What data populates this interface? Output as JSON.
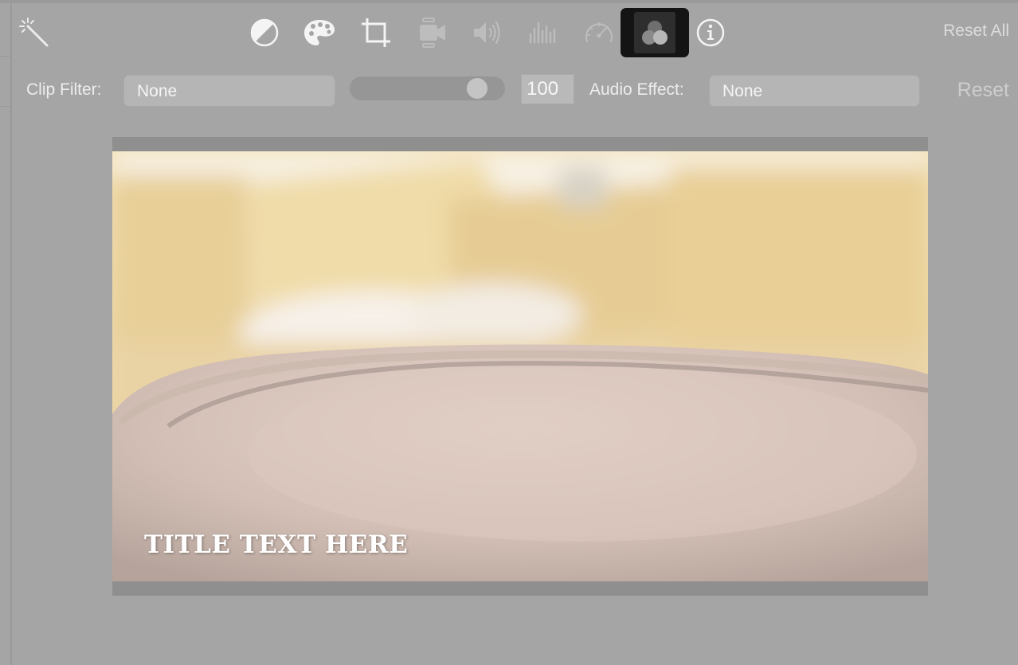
{
  "toolbar": {
    "icons": [
      "magic-wand-icon",
      "color-balance-icon",
      "color-palette-icon",
      "crop-icon",
      "video-camera-icon",
      "speaker-icon",
      "equalizer-icon",
      "speedometer-icon",
      "clip-filter-icon",
      "info-icon"
    ],
    "selected": "clip-filter-icon",
    "reset_all_label": "Reset All"
  },
  "clip_filter": {
    "label": "Clip Filter:",
    "value": "None",
    "intensity": "100",
    "intensity_fraction": 0.88
  },
  "audio_effect": {
    "label": "Audio Effect:",
    "value": "None"
  },
  "reset_label": "Reset",
  "viewer": {
    "title_text": "TITLE TEXT HERE"
  },
  "colors": {
    "background": "#a5a5a5",
    "selected_tool": "#141414",
    "text": "#ededed"
  }
}
